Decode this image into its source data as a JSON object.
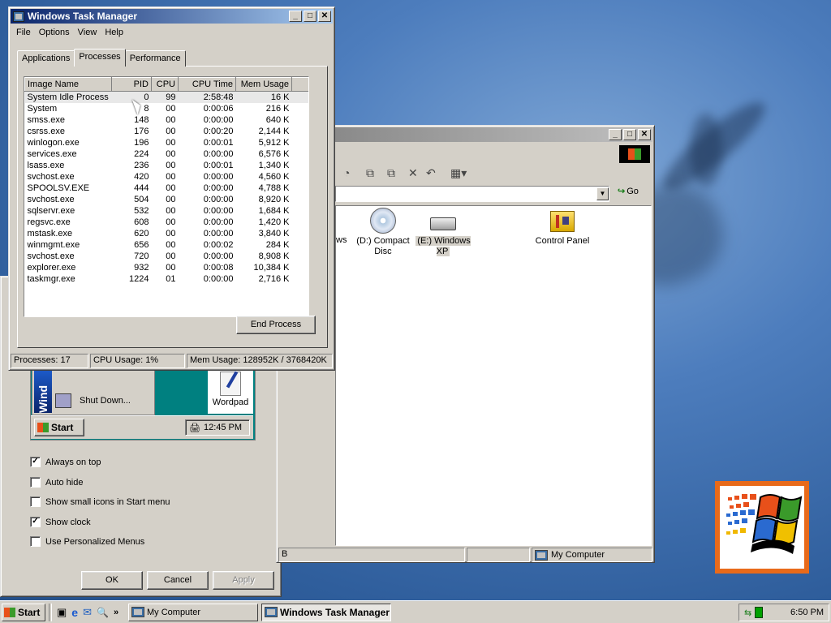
{
  "taskmanager": {
    "title": "Windows Task Manager",
    "menu": [
      "File",
      "Options",
      "View",
      "Help"
    ],
    "tabs": [
      "Applications",
      "Processes",
      "Performance"
    ],
    "columns": [
      "Image Name",
      "PID",
      "CPU",
      "CPU Time",
      "Mem Usage"
    ],
    "processes": [
      [
        "System Idle Process",
        "0",
        "99",
        "2:58:48",
        "16 K"
      ],
      [
        "System",
        "8",
        "00",
        "0:00:06",
        "216 K"
      ],
      [
        "smss.exe",
        "148",
        "00",
        "0:00:00",
        "640 K"
      ],
      [
        "csrss.exe",
        "176",
        "00",
        "0:00:20",
        "2,144 K"
      ],
      [
        "winlogon.exe",
        "196",
        "00",
        "0:00:01",
        "5,912 K"
      ],
      [
        "services.exe",
        "224",
        "00",
        "0:00:00",
        "6,576 K"
      ],
      [
        "lsass.exe",
        "236",
        "00",
        "0:00:01",
        "1,340 K"
      ],
      [
        "svchost.exe",
        "420",
        "00",
        "0:00:00",
        "4,560 K"
      ],
      [
        "SPOOLSV.EXE",
        "444",
        "00",
        "0:00:00",
        "4,788 K"
      ],
      [
        "svchost.exe",
        "504",
        "00",
        "0:00:00",
        "8,920 K"
      ],
      [
        "sqlservr.exe",
        "532",
        "00",
        "0:00:00",
        "1,684 K"
      ],
      [
        "regsvc.exe",
        "608",
        "00",
        "0:00:00",
        "1,420 K"
      ],
      [
        "mstask.exe",
        "620",
        "00",
        "0:00:00",
        "3,840 K"
      ],
      [
        "winmgmt.exe",
        "656",
        "00",
        "0:00:02",
        "284 K"
      ],
      [
        "svchost.exe",
        "720",
        "00",
        "0:00:00",
        "8,908 K"
      ],
      [
        "explorer.exe",
        "932",
        "00",
        "0:00:08",
        "10,384 K"
      ],
      [
        "taskmgr.exe",
        "1224",
        "01",
        "0:00:00",
        "2,716 K"
      ]
    ],
    "end_process": "End Process",
    "status": {
      "processes": "Processes: 17",
      "cpu": "CPU Usage: 1%",
      "mem": "Mem Usage: 128952K / 3768420K"
    }
  },
  "explorer": {
    "partial_label": "ws",
    "drives": [
      {
        "label": "(D:) Compact Disc",
        "icon": "cd-drive-icon"
      },
      {
        "label": "(E:) Windows XP",
        "icon": "disk-drive-icon"
      },
      {
        "label": "Control Panel",
        "icon": "control-panel-icon"
      }
    ],
    "go": "Go",
    "status_left": "B",
    "status_right": "My Computer"
  },
  "taskbar_props": {
    "preview_time": "12:45 PM",
    "preview_start": "Start",
    "shutdown": "Shut Down...",
    "wordpad": "Wordpad",
    "options": [
      {
        "label": "Always on top",
        "checked": true
      },
      {
        "label": "Auto hide",
        "checked": false
      },
      {
        "label": "Show small icons in Start menu",
        "checked": false
      },
      {
        "label": "Show clock",
        "checked": true
      },
      {
        "label": "Use Personalized Menus",
        "checked": false
      }
    ],
    "ok": "OK",
    "cancel": "Cancel",
    "apply": "Apply"
  },
  "taskbar": {
    "start": "Start",
    "items": [
      "My Computer",
      "Windows Task Manager"
    ],
    "time": "6:50 PM"
  },
  "colors": {
    "titlebar_active": "#0a246a",
    "desktop": "#3d6aa3",
    "logo_border": "#e86a1a"
  }
}
